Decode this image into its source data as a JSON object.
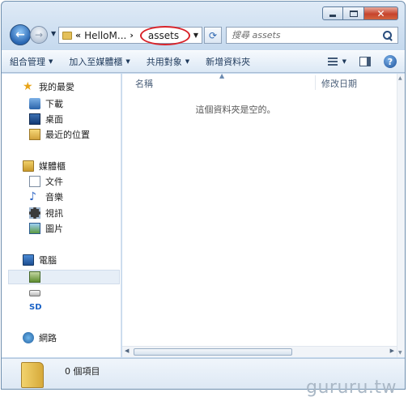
{
  "address": {
    "segments": [
      "«",
      "HelloM...",
      "›"
    ],
    "current": "assets"
  },
  "search": {
    "placeholder": "搜尋 assets"
  },
  "toolbar": {
    "organize": "組合管理",
    "add_to_library": "加入至媒體櫃",
    "share": "共用對象",
    "new_folder": "新增資料夾"
  },
  "sidebar": {
    "favorites": "我的最愛",
    "downloads": "下載",
    "desktop": "桌面",
    "recent": "最近的位置",
    "libraries": "媒體櫃",
    "documents": "文件",
    "music": "音樂",
    "videos": "視訊",
    "pictures": "圖片",
    "computer": "電腦",
    "sd": "SD",
    "network": "網路"
  },
  "columns": {
    "name": "名稱",
    "date": "修改日期"
  },
  "content": {
    "empty_message": "這個資料夾是空的。"
  },
  "details": {
    "count": "0 個項目"
  },
  "watermark": "gururu.tw"
}
